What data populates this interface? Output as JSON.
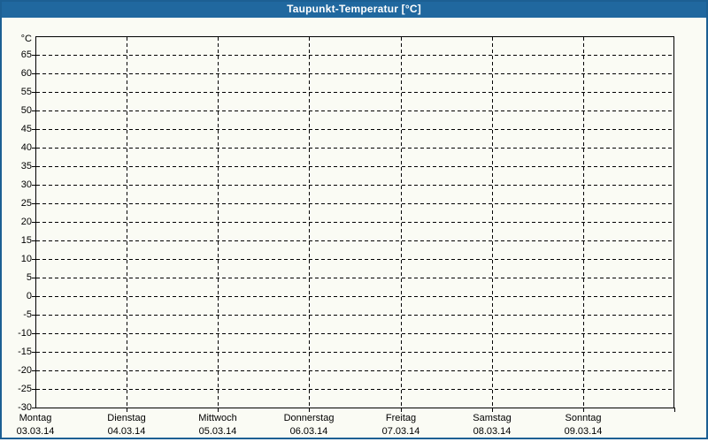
{
  "window": {
    "title": "Taupunkt-Temperatur [°C]"
  },
  "colors": {
    "titlebar_bg": "#20689F",
    "titlebar_text": "#FFFFFF",
    "window_border": "#1C5F93",
    "content_bg": "#FAFBF4",
    "axis": "#000000",
    "grid": "#000000",
    "label_text": "#000000"
  },
  "chart_data": {
    "type": "line",
    "title": "Taupunkt-Temperatur [°C]",
    "grid": "dashed",
    "legend": "none",
    "y_axis": {
      "unit_label": "°C",
      "min": -30,
      "max": 70,
      "tick_step": 5,
      "tick_labels": [
        65,
        60,
        55,
        50,
        45,
        40,
        35,
        30,
        25,
        20,
        15,
        10,
        5,
        0,
        -5,
        -10,
        -15,
        -20,
        -25,
        -30
      ]
    },
    "x_axis": {
      "days": [
        {
          "name": "Montag",
          "date": "03.03.14"
        },
        {
          "name": "Dienstag",
          "date": "04.03.14"
        },
        {
          "name": "Mittwoch",
          "date": "05.03.14"
        },
        {
          "name": "Donnerstag",
          "date": "06.03.14"
        },
        {
          "name": "Freitag",
          "date": "07.03.14"
        },
        {
          "name": "Samstag",
          "date": "08.03.14"
        },
        {
          "name": "Sonntag",
          "date": "09.03.14"
        }
      ]
    },
    "series": []
  }
}
